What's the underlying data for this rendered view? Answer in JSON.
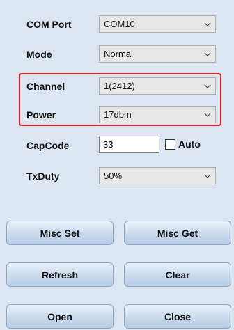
{
  "fields": {
    "com_port": {
      "label": "COM Port",
      "value": "COM10"
    },
    "mode": {
      "label": "Mode",
      "value": "Normal"
    },
    "channel": {
      "label": "Channel",
      "value": "1(2412)"
    },
    "power": {
      "label": "Power",
      "value": "17dbm"
    },
    "capcode": {
      "label": "CapCode",
      "value": "33"
    },
    "auto": {
      "label": "Auto",
      "checked": false
    },
    "txduty": {
      "label": "TxDuty",
      "value": "50%"
    }
  },
  "buttons": {
    "misc_set": "Misc Set",
    "misc_get": "Misc Get",
    "refresh": "Refresh",
    "clear": "Clear",
    "open": "Open",
    "close": "Close"
  },
  "colors": {
    "background": "#dbe6f2",
    "highlight": "#e02020",
    "button_top": "#e9f1fa",
    "button_bottom": "#b8cde6"
  },
  "icons": {
    "dropdown": "chevron-down-icon"
  }
}
